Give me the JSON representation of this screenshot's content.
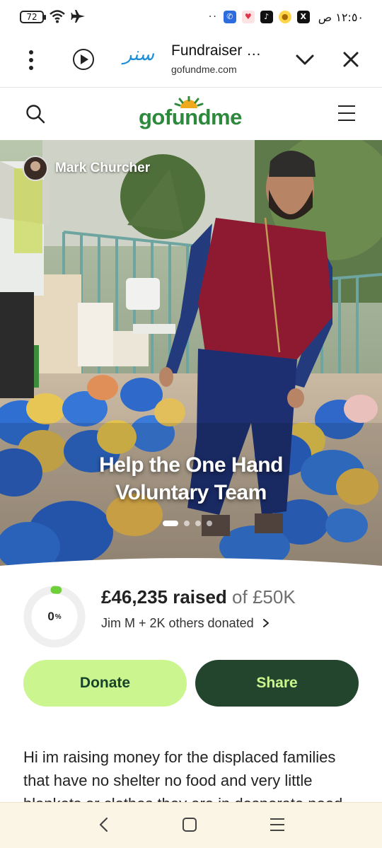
{
  "status_bar": {
    "battery": "72",
    "time": "١٢:٥٠ ص",
    "icons": [
      "wifi-icon",
      "airplane-icon",
      "phone-app-icon",
      "heart-app-icon",
      "tiktok-icon",
      "circle-app-icon",
      "x-app-icon"
    ]
  },
  "browser": {
    "site_logo": "سنر",
    "title": "Fundraiser …",
    "url": "gofundme.com",
    "icons": [
      "more-vert-icon",
      "play-icon",
      "chevron-down-icon",
      "close-icon"
    ]
  },
  "header": {
    "logo": "gofundme",
    "icons": [
      "search-icon",
      "hamburger-menu-icon"
    ]
  },
  "hero": {
    "organizer": "Mark Churcher",
    "title_line1": "Help the One Hand",
    "title_line2": "Voluntary Team",
    "slide_count": 4,
    "active_slide": 1
  },
  "progress": {
    "percent_label": "0",
    "percent_sign": "%",
    "ring_fraction": 0.02,
    "raised": "£46,235 raised",
    "goal": "of £50K",
    "donors": "Jim M + 2K others donated",
    "accent": "#6fcf3a"
  },
  "actions": {
    "donate": "Donate",
    "share": "Share",
    "donate_color": "#cbf58f",
    "share_color": "#23452e"
  },
  "description": "Hi im raising money for the displaced families that have no shelter no food and very little blankets or clothes they are in desperate need"
}
